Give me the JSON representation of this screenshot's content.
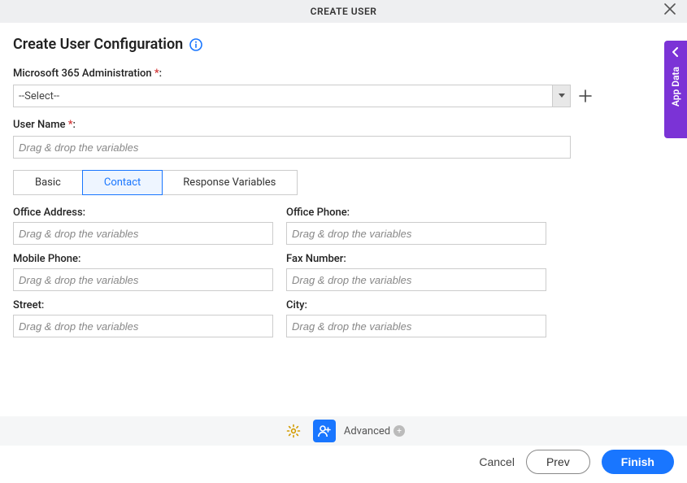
{
  "header": {
    "title": "CREATE USER"
  },
  "page_title": "Create User Configuration",
  "admin": {
    "label_prefix": "Microsoft 365 Administration ",
    "required": "*",
    "colon": ":",
    "selected": "--Select--"
  },
  "username": {
    "label_prefix": "User Name ",
    "required": "*",
    "colon": ":",
    "placeholder": "Drag & drop the variables"
  },
  "tabs": {
    "basic": "Basic",
    "contact": "Contact",
    "response": "Response Variables"
  },
  "fields": {
    "office_address": {
      "label": "Office Address:",
      "placeholder": "Drag & drop the variables"
    },
    "office_phone": {
      "label": "Office Phone:",
      "placeholder": "Drag & drop the variables"
    },
    "mobile_phone": {
      "label": "Mobile Phone:",
      "placeholder": "Drag & drop the variables"
    },
    "fax_number": {
      "label": "Fax Number:",
      "placeholder": "Drag & drop the variables"
    },
    "street": {
      "label": "Street:",
      "placeholder": "Drag & drop the variables"
    },
    "city": {
      "label": "City:",
      "placeholder": "Drag & drop the variables"
    },
    "state": {
      "label": " ",
      "placeholder": ""
    },
    "zip": {
      "label": " ",
      "placeholder": ""
    }
  },
  "side_tab": "App Data",
  "bottom": {
    "advanced": "Advanced"
  },
  "actions": {
    "cancel": "Cancel",
    "prev": "Prev",
    "finish": "Finish"
  }
}
